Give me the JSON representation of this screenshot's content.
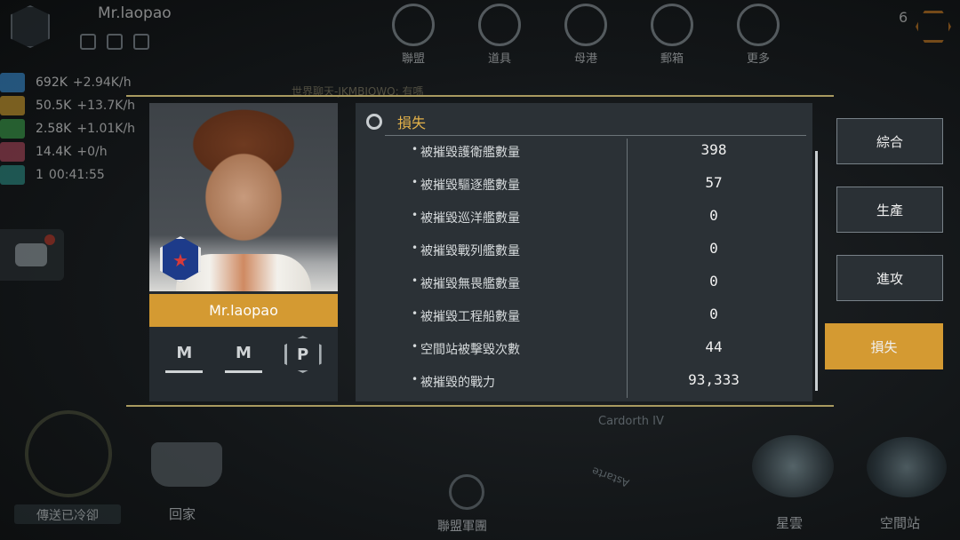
{
  "player": {
    "name": "Mr.laopao"
  },
  "resources": [
    {
      "icon": "crystal-icon",
      "amount": "692K",
      "rate": "+2.94K/h",
      "color": "#3a8fd6"
    },
    {
      "icon": "gas-icon",
      "amount": "50.5K",
      "rate": "+13.7K/h",
      "color": "#d4a02c"
    },
    {
      "icon": "ore-icon",
      "amount": "2.58K",
      "rate": "+1.01K/h",
      "color": "#3ba04a"
    },
    {
      "icon": "stack-icon",
      "amount": "14.4K",
      "rate": "+0/h",
      "color": "#b0475b"
    },
    {
      "icon": "eye-icon",
      "amount": "1",
      "rate": "00:41:55",
      "color": "#2d8f86"
    }
  ],
  "top_menu": [
    "聯盟",
    "道具",
    "母港",
    "郵箱",
    "更多"
  ],
  "top_right_counter": "6",
  "world_message": "世界聊天-JKMBIQWQ: 有嗎",
  "bottom_hud": {
    "warp_label": "傳送已冷卻",
    "home_label": "回家",
    "fleet_label": "聯盟軍團",
    "nebula_label": "星雲",
    "station_label": "空間站",
    "map_label_1": "Cardorth IV",
    "map_label_2": "Astarte"
  },
  "dialog": {
    "section_title": "損失",
    "stats": [
      {
        "label": "被摧毀護衛艦數量",
        "value": "398"
      },
      {
        "label": "被摧毀驅逐艦數量",
        "value": "57"
      },
      {
        "label": "被摧毀巡洋艦數量",
        "value": "0"
      },
      {
        "label": "被摧毀戰列艦數量",
        "value": "0"
      },
      {
        "label": "被摧毀無畏艦數量",
        "value": "0"
      },
      {
        "label": "被摧毀工程船數量",
        "value": "0"
      },
      {
        "label": "空間站被擊毀次數",
        "value": "44"
      },
      {
        "label": "被摧毀的戰力",
        "value": "93,333"
      }
    ],
    "badges": [
      "M",
      "M",
      "P"
    ]
  },
  "tabs": [
    {
      "label": "綜合",
      "active": false
    },
    {
      "label": "生產",
      "active": false
    },
    {
      "label": "進攻",
      "active": false
    },
    {
      "label": "損失",
      "active": true
    }
  ],
  "colors": {
    "accent": "#d49a32",
    "title": "#e2b14a"
  }
}
